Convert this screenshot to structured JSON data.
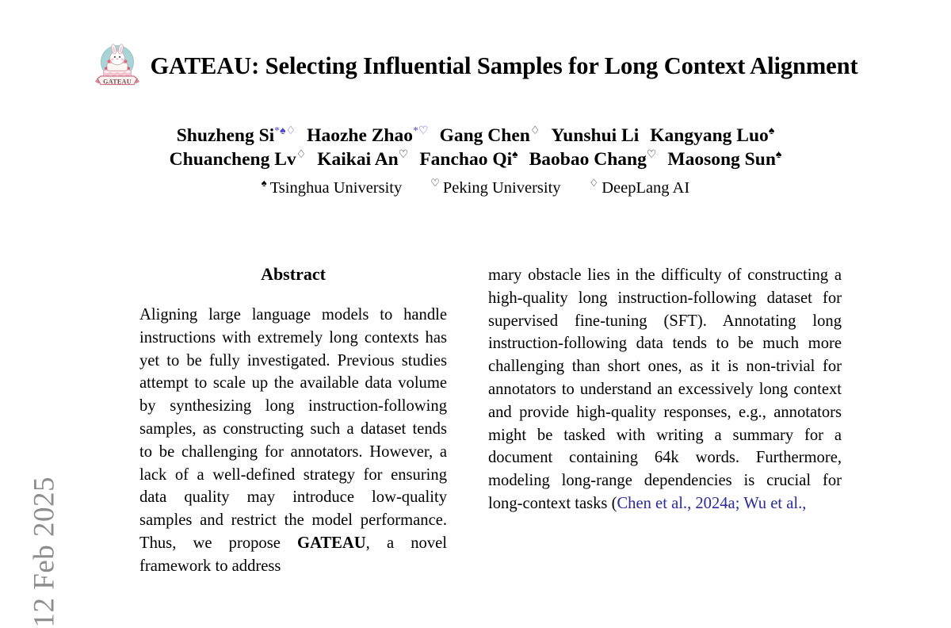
{
  "stamp": {
    "text": "12 Feb 2025"
  },
  "title": {
    "text": "GATEAU: Selecting Influential Samples for Long Context Alignment",
    "logo_alt": "gateau-cake-logo"
  },
  "authors": {
    "line1": [
      {
        "name": "Shuzheng Si",
        "symbols": "*♠♢",
        "star": true
      },
      {
        "name": "Haozhe Zhao",
        "symbols": "*♡",
        "star": true
      },
      {
        "name": "Gang Chen",
        "symbols": "♢",
        "star": false
      },
      {
        "name": "Yunshui Li",
        "symbols": "",
        "star": false
      },
      {
        "name": "Kangyang Luo",
        "symbols": "♠",
        "star": false
      }
    ],
    "line2": [
      {
        "name": "Chuancheng Lv",
        "symbols": "♢",
        "star": false
      },
      {
        "name": "Kaikai An",
        "symbols": "♡",
        "star": false
      },
      {
        "name": "Fanchao Qi",
        "symbols": "♠",
        "star": false
      },
      {
        "name": "Baobao Chang",
        "symbols": "♡",
        "star": false
      },
      {
        "name": "Maosong Sun",
        "symbols": "♠",
        "star": false
      }
    ],
    "affiliations": [
      {
        "symbol": "♠",
        "name": "Tsinghua University"
      },
      {
        "symbol": "♡",
        "name": "Peking University"
      },
      {
        "symbol": "♢",
        "name": "DeepLang AI"
      }
    ]
  },
  "abstract": {
    "heading": "Abstract",
    "text_before_bold": "Aligning large language models to handle instructions with extremely long contexts has yet to be fully investigated. Previous studies attempt to scale up the available data volume by synthesizing long instruction-following samples, as constructing such a dataset tends to be challenging for annotators. However, a lack of a well-defined strategy for ensuring data quality may introduce low-quality samples and restrict the model performance. Thus, we propose ",
    "bold_term": "GATEAU",
    "text_after_bold": ", a novel framework to address"
  },
  "intro": {
    "text_before_cite": "mary obstacle lies in the difficulty of constructing a high-quality long instruction-following dataset for supervised fine-tuning (SFT). Annotating long instruction-following data tends to be much more challenging than short ones, as it is non-trivial for annotators to understand an excessively long context and provide high-quality responses, e.g., annotators might be tasked with writing a summary for a document containing 64k words. Furthermore, modeling long-range dependencies is crucial for long-context tasks (",
    "citation": "Chen et al., 2024a; Wu et al.,",
    "text_after_cite": ""
  },
  "colors": {
    "citation_blue": "#2a2a9c",
    "stamp_gray": "#8d8d8d",
    "star_blue": "#4b4bc8"
  }
}
